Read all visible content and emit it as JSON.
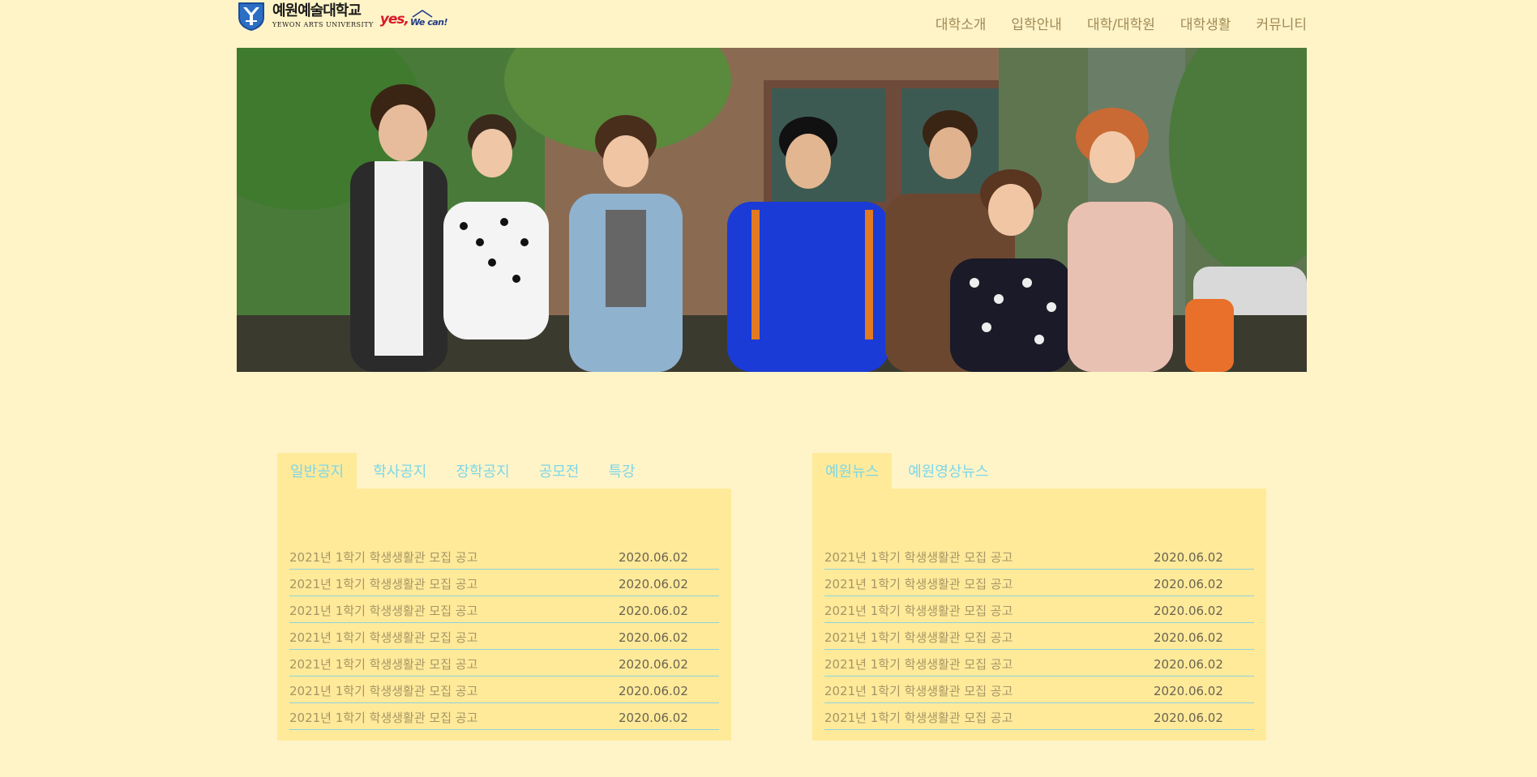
{
  "header": {
    "logo_kor": "예원예술대학교",
    "logo_eng": "YEWON ARTS UNIVERSITY",
    "slogan_yes": "yes,",
    "slogan_wecan": "We can!",
    "logo_icon": "university-shield-icon"
  },
  "nav": {
    "items": [
      {
        "label": "대학소개"
      },
      {
        "label": "입학안내"
      },
      {
        "label": "대학/대학원"
      },
      {
        "label": "대학생활"
      },
      {
        "label": "커뮤니티"
      }
    ]
  },
  "hero": {
    "description_icon": "students-walking-photo"
  },
  "notice_board": {
    "tabs": [
      {
        "label": "일반공지"
      },
      {
        "label": "학사공지"
      },
      {
        "label": "장학공지"
      },
      {
        "label": "공모전"
      },
      {
        "label": "특강"
      }
    ],
    "active_tab": 0,
    "rows": [
      {
        "title": "2021년 1학기 학생생활관 모집 공고",
        "date": "2020.06.02"
      },
      {
        "title": "2021년 1학기 학생생활관 모집 공고",
        "date": "2020.06.02"
      },
      {
        "title": "2021년 1학기 학생생활관 모집 공고",
        "date": "2020.06.02"
      },
      {
        "title": "2021년 1학기 학생생활관 모집 공고",
        "date": "2020.06.02"
      },
      {
        "title": "2021년 1학기 학생생활관 모집 공고",
        "date": "2020.06.02"
      },
      {
        "title": "2021년 1학기 학생생활관 모집 공고",
        "date": "2020.06.02"
      },
      {
        "title": "2021년 1학기 학생생활관 모집 공고",
        "date": "2020.06.02"
      }
    ]
  },
  "news_board": {
    "tabs": [
      {
        "label": "예원뉴스"
      },
      {
        "label": "예원영상뉴스"
      }
    ],
    "active_tab": 0,
    "rows": [
      {
        "title": "2021년 1학기 학생생활관 모집 공고",
        "date": "2020.06.02"
      },
      {
        "title": "2021년 1학기 학생생활관 모집 공고",
        "date": "2020.06.02"
      },
      {
        "title": "2021년 1학기 학생생활관 모집 공고",
        "date": "2020.06.02"
      },
      {
        "title": "2021년 1학기 학생생활관 모집 공고",
        "date": "2020.06.02"
      },
      {
        "title": "2021년 1학기 학생생활관 모집 공고",
        "date": "2020.06.02"
      },
      {
        "title": "2021년 1학기 학생생활관 모집 공고",
        "date": "2020.06.02"
      },
      {
        "title": "2021년 1학기 학생생활관 모집 공고",
        "date": "2020.06.02"
      }
    ]
  },
  "colors": {
    "page_bg": "#fff4c8",
    "panel_bg": "#ffea9a",
    "tab_text": "#7dd6e8",
    "nav_text": "#a08a56",
    "row_divider": "#8dd3df"
  }
}
